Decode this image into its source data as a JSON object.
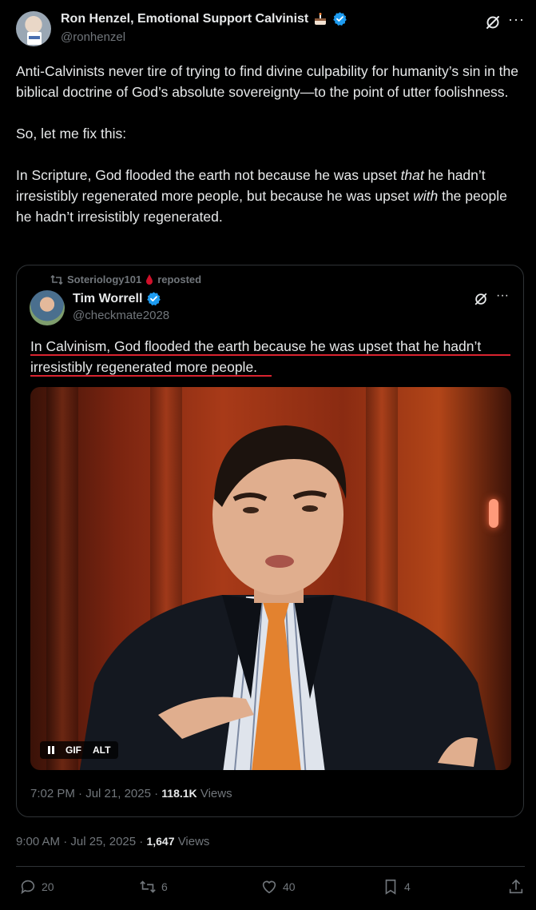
{
  "post": {
    "author_name": "Ron Henzel, Emotional Support Calvinist",
    "author_handle": "@ronhenzel",
    "paragraphs": [
      "Anti-Calvinists never tire of trying to find divine culpability for humanity’s sin in the biblical doctrine of God’s absolute sovereignty—to the point of utter foolishness.",
      "So, let me fix this:"
    ],
    "p3_part1": "In Scripture, God flooded the earth not because he was upset ",
    "p3_em1": "that",
    "p3_part2": " he hadn’t irresistibly regenerated more people, but because he was upset ",
    "p3_em2": "with",
    "p3_part3": " the people he hadn’t irresistibly regenerated.",
    "time": "9:00 AM",
    "date": "Jul 25, 2025",
    "views_count": "1,647",
    "views_label": "Views"
  },
  "quote": {
    "reposter": "Soteriology101",
    "reposted_label": "reposted",
    "author_name": "Tim Worrell",
    "author_handle": "@checkmate2028",
    "text": "In Calvinism, God flooded the earth because he was upset that he hadn’t irresistibly regenerated more people.",
    "media_badges": {
      "gif": "GIF",
      "alt": "ALT"
    },
    "time": "7:02 PM",
    "date": "Jul 21, 2025",
    "views_count": "118.1K",
    "views_label": "Views"
  },
  "actions": {
    "replies": "20",
    "reposts": "6",
    "likes": "40",
    "bookmarks": "4"
  },
  "colors": {
    "background": "#000000",
    "text": "#e7e9ea",
    "muted": "#71767b",
    "verified": "#1d9bf0",
    "underline": "#d9232f",
    "border": "#2f3336"
  },
  "icons": [
    "cake-icon",
    "verified-icon",
    "grok-icon",
    "more-icon",
    "repost-icon",
    "drop-icon",
    "pause-icon",
    "reply-icon",
    "like-icon",
    "bookmark-icon",
    "share-icon"
  ]
}
